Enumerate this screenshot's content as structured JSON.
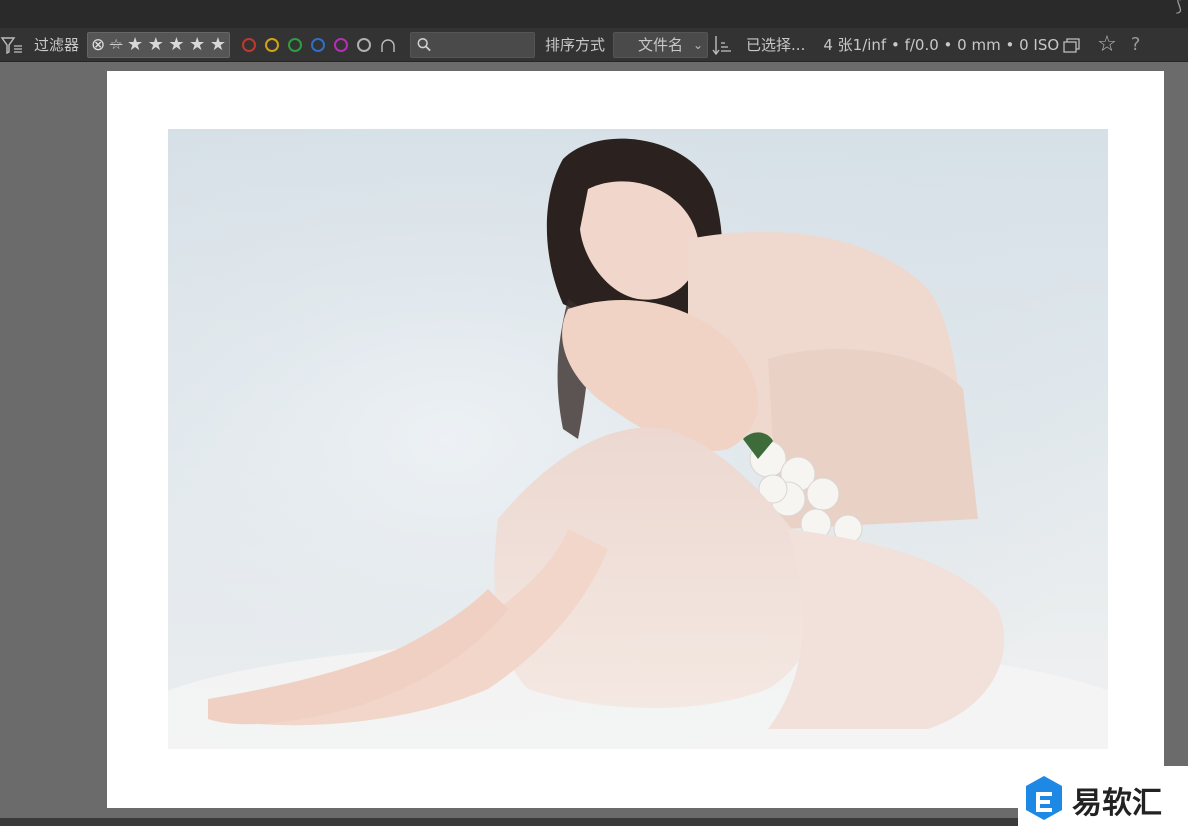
{
  "toolbar": {
    "filter_label": "过滤器",
    "rating": {
      "reject_glyph": "⊗",
      "unrated_glyph": "☆",
      "stars": [
        "★",
        "★",
        "★",
        "★",
        "★"
      ]
    },
    "color_labels": [
      "red",
      "yellow",
      "green",
      "blue",
      "magenta",
      "gray"
    ],
    "color_hex": [
      "#c0392b",
      "#d4a017",
      "#2e9e3e",
      "#2f6fc6",
      "#b52fb5",
      "#b0b0b0"
    ],
    "search_placeholder": "",
    "sort_label": "排序方式",
    "sort_value": "文件名",
    "selected_text": "已选择...",
    "image_info": "4 张1/inf • f/0.0 • 0 mm • 0 ISO",
    "icons": [
      "filter-icon",
      "search-icon",
      "sort-direction-icon",
      "grouping-icon",
      "star-icon",
      "help-icon"
    ]
  },
  "colors": {
    "toolbar_bg": "#333333",
    "panel_bg": "#6b6b6b",
    "paper": "#ffffff"
  },
  "watermark": {
    "text": "易软汇"
  }
}
